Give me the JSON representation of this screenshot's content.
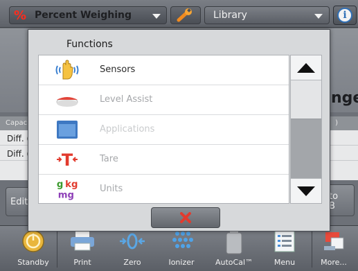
{
  "header": {
    "app_icon": "percent-icon",
    "app_name": "Percent Weighing",
    "settings_icon": "wrench-icon",
    "library_label": "Library",
    "info_icon": "info-icon"
  },
  "background": {
    "weight_text_fragment": "nge",
    "table_header_left": "Capacit",
    "table_header_right": ")",
    "rows": [
      "Diff. (v",
      "Diff. (%"
    ],
    "edit_button_label": "Edit S",
    "right_button_line1": "to",
    "right_button_line2": "B"
  },
  "dialog": {
    "title": "Functions",
    "items": [
      {
        "label": "Sensors",
        "icon": "hand-sensor-icon",
        "state": "enabled"
      },
      {
        "label": "Level Assist",
        "icon": "level-bubble-icon",
        "state": "disabled"
      },
      {
        "label": "Applications",
        "icon": "applications-window-icon",
        "state": "faint"
      },
      {
        "label": "Tare",
        "icon": "tare-icon",
        "state": "disabled"
      },
      {
        "label": "Units",
        "icon": "units-icon",
        "state": "disabled"
      }
    ],
    "units_icon_text": {
      "top_left": "g",
      "top_right": "kg",
      "bottom": "mg"
    },
    "tare_icon_text": "T",
    "scroll_up_icon": "triangle-up-icon",
    "scroll_down_icon": "triangle-down-icon",
    "close_icon": "x-close-icon",
    "colors": {
      "close_x": "#e23b2e",
      "accent_red": "#ff2b1c",
      "info_blue": "#2f6fb6"
    }
  },
  "toolbar": {
    "items": [
      {
        "label": "Standby",
        "icon": "standby-icon"
      },
      {
        "label": "Print",
        "icon": "printer-icon"
      },
      {
        "label": "Zero",
        "icon": "zero-icon"
      },
      {
        "label": "Ionizer",
        "icon": "ionizer-icon"
      },
      {
        "label": "AutoCal™",
        "icon": "autocal-weight-icon"
      },
      {
        "label": "Menu",
        "icon": "menu-list-icon"
      },
      {
        "label": "More...",
        "icon": "more-icon"
      }
    ]
  }
}
